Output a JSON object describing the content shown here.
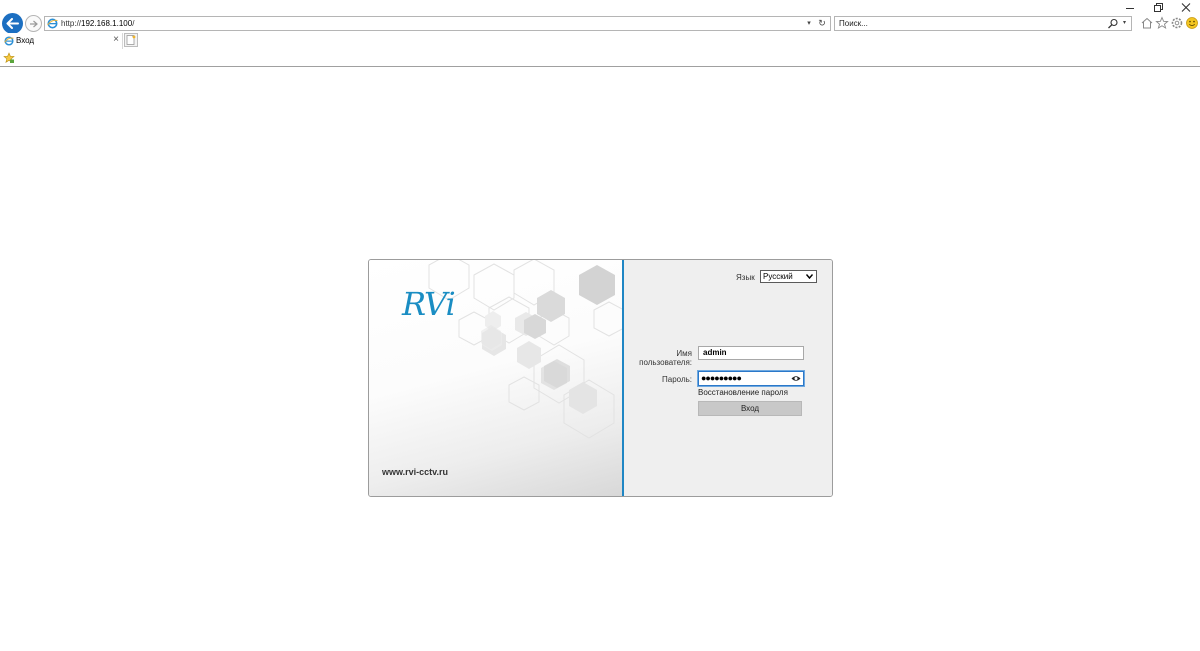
{
  "browser": {
    "address": {
      "scheme": "http://",
      "host": "192.168.1.100",
      "path": "/"
    },
    "search": {
      "placeholder": "Поиск..."
    },
    "tab": {
      "title": "Вход",
      "close": "×"
    },
    "icons": [
      "back-arrow-icon",
      "forward-arrow-icon",
      "ie-favicon-icon",
      "refresh-icon",
      "search-icon",
      "home-icon",
      "favorites-star-icon",
      "settings-gear-icon",
      "smiley-feedback-icon",
      "minimize-icon",
      "restore-icon",
      "close-icon"
    ]
  },
  "login": {
    "logo": "RVi",
    "site_url": "www.rvi-cctv.ru",
    "language_label": "Язык",
    "language_value": "Русский",
    "username_label": "Имя пользователя:",
    "username_value": "admin",
    "password_label": "Пароль:",
    "password_mask": "●●●●●●●●●",
    "recover_link": "Восстановление пароля",
    "login_button": "Вход",
    "accent_color": "#1f86c4"
  }
}
